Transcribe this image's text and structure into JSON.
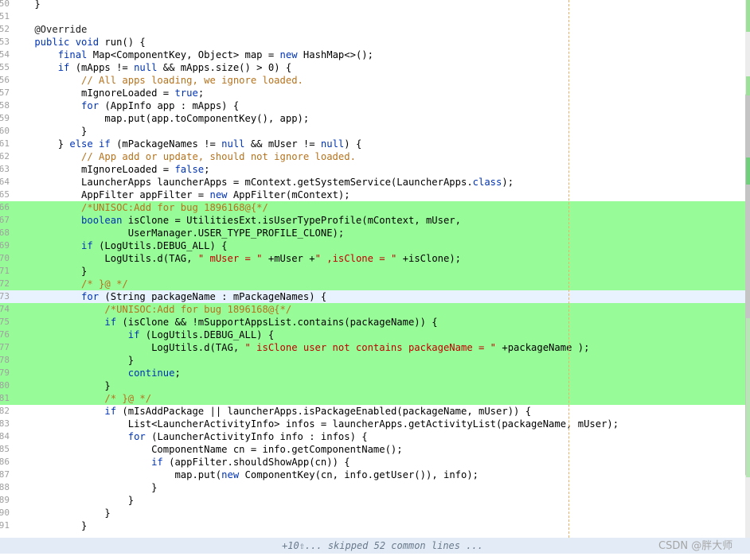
{
  "editor": {
    "lines": [
      {
        "no": "50",
        "hl": "",
        "seg": [
          {
            "c": "",
            "t": "    }"
          }
        ]
      },
      {
        "no": "51",
        "hl": "",
        "seg": []
      },
      {
        "no": "52",
        "hl": "",
        "seg": [
          {
            "c": "an",
            "t": "    @Override"
          }
        ]
      },
      {
        "no": "53",
        "hl": "",
        "seg": [
          {
            "c": "kw",
            "t": "    public void "
          },
          {
            "c": "",
            "t": "run() {"
          }
        ]
      },
      {
        "no": "54",
        "hl": "",
        "seg": [
          {
            "c": "kw",
            "t": "        final "
          },
          {
            "c": "",
            "t": "Map<ComponentKey, Object> map = "
          },
          {
            "c": "kw",
            "t": "new "
          },
          {
            "c": "",
            "t": "HashMap<>();"
          }
        ]
      },
      {
        "no": "55",
        "hl": "",
        "seg": [
          {
            "c": "kw",
            "t": "        if "
          },
          {
            "c": "",
            "t": "(mApps != "
          },
          {
            "c": "kw",
            "t": "null "
          },
          {
            "c": "",
            "t": "&& mApps.size() > 0) {"
          }
        ]
      },
      {
        "no": "56",
        "hl": "",
        "seg": [
          {
            "c": "cm",
            "t": "            // All apps loading, we ignore loaded."
          }
        ]
      },
      {
        "no": "57",
        "hl": "",
        "seg": [
          {
            "c": "",
            "t": "            mIgnoreLoaded = "
          },
          {
            "c": "kw",
            "t": "true"
          },
          {
            "c": "",
            "t": ";"
          }
        ]
      },
      {
        "no": "58",
        "hl": "",
        "seg": [
          {
            "c": "kw",
            "t": "            for "
          },
          {
            "c": "",
            "t": "(AppInfo app : mApps) {"
          }
        ]
      },
      {
        "no": "59",
        "hl": "",
        "seg": [
          {
            "c": "",
            "t": "                map.put(app.toComponentKey(), app);"
          }
        ]
      },
      {
        "no": "60",
        "hl": "",
        "seg": [
          {
            "c": "",
            "t": "            }"
          }
        ]
      },
      {
        "no": "61",
        "hl": "",
        "seg": [
          {
            "c": "",
            "t": "        } "
          },
          {
            "c": "kw",
            "t": "else if "
          },
          {
            "c": "",
            "t": "(mPackageNames != "
          },
          {
            "c": "kw",
            "t": "null "
          },
          {
            "c": "",
            "t": "&& mUser != "
          },
          {
            "c": "kw",
            "t": "null"
          },
          {
            "c": "",
            "t": ") {"
          }
        ]
      },
      {
        "no": "62",
        "hl": "",
        "seg": [
          {
            "c": "cm",
            "t": "            // App add or update, should not ignore loaded."
          }
        ]
      },
      {
        "no": "63",
        "hl": "",
        "seg": [
          {
            "c": "",
            "t": "            mIgnoreLoaded = "
          },
          {
            "c": "kw",
            "t": "false"
          },
          {
            "c": "",
            "t": ";"
          }
        ]
      },
      {
        "no": "64",
        "hl": "",
        "seg": [
          {
            "c": "",
            "t": "            LauncherApps launcherApps = mContext.getSystemService(LauncherApps."
          },
          {
            "c": "kw",
            "t": "class"
          },
          {
            "c": "",
            "t": ");"
          }
        ]
      },
      {
        "no": "65",
        "hl": "",
        "seg": [
          {
            "c": "",
            "t": "            AppFilter appFilter = "
          },
          {
            "c": "kw",
            "t": "new "
          },
          {
            "c": "",
            "t": "AppFilter(mContext);"
          }
        ]
      },
      {
        "no": "66",
        "hl": "hl",
        "seg": [
          {
            "c": "cm",
            "t": "            /*UNISOC:Add for bug 1896168@{*/"
          }
        ]
      },
      {
        "no": "67",
        "hl": "hl",
        "seg": [
          {
            "c": "kw",
            "t": "            boolean "
          },
          {
            "c": "",
            "t": "isClone = UtilitiesExt.isUserTypeProfile(mContext, mUser,"
          }
        ]
      },
      {
        "no": "68",
        "hl": "hl",
        "seg": [
          {
            "c": "",
            "t": "                    UserManager.USER_TYPE_PROFILE_CLONE);"
          }
        ]
      },
      {
        "no": "69",
        "hl": "hl",
        "seg": [
          {
            "c": "kw",
            "t": "            if "
          },
          {
            "c": "",
            "t": "(LogUtils.DEBUG_ALL) {"
          }
        ]
      },
      {
        "no": "70",
        "hl": "hl",
        "seg": [
          {
            "c": "",
            "t": "                LogUtils.d(TAG, "
          },
          {
            "c": "st",
            "t": "\" mUser = \""
          },
          {
            "c": "",
            "t": " +mUser +"
          },
          {
            "c": "st",
            "t": "\" ,isClone = \""
          },
          {
            "c": "",
            "t": " +isClone);"
          }
        ]
      },
      {
        "no": "71",
        "hl": "hl",
        "seg": [
          {
            "c": "",
            "t": "            }"
          }
        ]
      },
      {
        "no": "72",
        "hl": "hl",
        "seg": [
          {
            "c": "cm",
            "t": "            /* }@ */"
          }
        ]
      },
      {
        "no": "73",
        "hl": "cur",
        "seg": [
          {
            "c": "kw",
            "t": "            for "
          },
          {
            "c": "",
            "t": "(String packageName : mPackageNames) {"
          }
        ]
      },
      {
        "no": "74",
        "hl": "hl",
        "seg": [
          {
            "c": "cm",
            "t": "                /*UNISOC:Add for bug 1896168@{*/"
          }
        ]
      },
      {
        "no": "75",
        "hl": "hl",
        "seg": [
          {
            "c": "kw",
            "t": "                if "
          },
          {
            "c": "",
            "t": "(isClone && !mSupportAppsList.contains(packageName)) {"
          }
        ]
      },
      {
        "no": "76",
        "hl": "hl",
        "seg": [
          {
            "c": "kw",
            "t": "                    if "
          },
          {
            "c": "",
            "t": "(LogUtils.DEBUG_ALL) {"
          }
        ]
      },
      {
        "no": "77",
        "hl": "hl",
        "seg": [
          {
            "c": "",
            "t": "                        LogUtils.d(TAG, "
          },
          {
            "c": "st",
            "t": "\" isClone user not contains packageName = \""
          },
          {
            "c": "",
            "t": " +packageName );"
          }
        ]
      },
      {
        "no": "78",
        "hl": "hl",
        "seg": [
          {
            "c": "",
            "t": "                    }"
          }
        ]
      },
      {
        "no": "79",
        "hl": "hl",
        "seg": [
          {
            "c": "kw",
            "t": "                    continue"
          },
          {
            "c": "",
            "t": ";"
          }
        ]
      },
      {
        "no": "80",
        "hl": "hl",
        "seg": [
          {
            "c": "",
            "t": "                }"
          }
        ]
      },
      {
        "no": "81",
        "hl": "hl",
        "seg": [
          {
            "c": "cm",
            "t": "                /* }@ */"
          }
        ]
      },
      {
        "no": "82",
        "hl": "",
        "seg": [
          {
            "c": "kw",
            "t": "                if "
          },
          {
            "c": "",
            "t": "(mIsAddPackage || launcherApps.isPackageEnabled(packageName, mUser)) {"
          }
        ]
      },
      {
        "no": "83",
        "hl": "",
        "seg": [
          {
            "c": "",
            "t": "                    List<LauncherActivityInfo> infos = launcherApps.getActivityList(packageName, mUser);"
          }
        ]
      },
      {
        "no": "84",
        "hl": "",
        "seg": [
          {
            "c": "kw",
            "t": "                    for "
          },
          {
            "c": "",
            "t": "(LauncherActivityInfo info : infos) {"
          }
        ]
      },
      {
        "no": "85",
        "hl": "",
        "seg": [
          {
            "c": "",
            "t": "                        ComponentName cn = info.getComponentName();"
          }
        ]
      },
      {
        "no": "86",
        "hl": "",
        "seg": [
          {
            "c": "kw",
            "t": "                        if "
          },
          {
            "c": "",
            "t": "(appFilter.shouldShowApp(cn)) {"
          }
        ]
      },
      {
        "no": "87",
        "hl": "",
        "seg": [
          {
            "c": "",
            "t": "                            map.put("
          },
          {
            "c": "kw",
            "t": "new "
          },
          {
            "c": "",
            "t": "ComponentKey(cn, info.getUser()), info);"
          }
        ]
      },
      {
        "no": "88",
        "hl": "",
        "seg": [
          {
            "c": "",
            "t": "                        }"
          }
        ]
      },
      {
        "no": "89",
        "hl": "",
        "seg": [
          {
            "c": "",
            "t": "                    }"
          }
        ]
      },
      {
        "no": "90",
        "hl": "",
        "seg": [
          {
            "c": "",
            "t": "                }"
          }
        ]
      },
      {
        "no": "91",
        "hl": "",
        "seg": [
          {
            "c": "",
            "t": "            }"
          }
        ]
      }
    ]
  },
  "footer": {
    "skip_prefix": "+10",
    "skip_icon": "expand-up-icon",
    "skip_text": "... skipped 52 common lines ..."
  },
  "watermark": "CSDN @胖大师",
  "colors": {
    "highlight": "#97fb98",
    "current_line": "#e8f2fe",
    "keyword": "#0033b3",
    "comment": "#b5731e",
    "string": "#c00000"
  }
}
